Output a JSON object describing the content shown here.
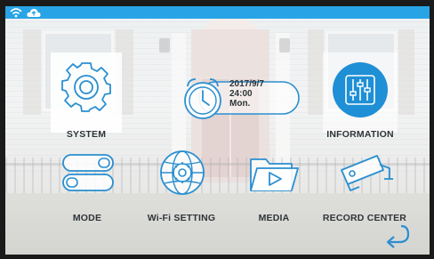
{
  "theme": {
    "accent": "#28a4e6",
    "icon_stroke": "#2a8fd0",
    "label_color": "#2f3438"
  },
  "statusbar": {
    "icons": [
      "wifi-icon",
      "cloud-upload-icon"
    ]
  },
  "clock": {
    "date": "2017/9/7",
    "time": "24:00",
    "day": "Mon."
  },
  "menu": {
    "system": {
      "label": "SYSTEM",
      "icon": "gear-icon"
    },
    "information": {
      "label": "INFORMATION",
      "icon": "sliders-icon",
      "selected": true
    },
    "mode": {
      "label": "MODE",
      "icon": "toggle-switches-icon"
    },
    "wifi_setting": {
      "label": "Wi-Fi SETTING",
      "icon": "globe-gear-icon"
    },
    "media": {
      "label": "MEDIA",
      "icon": "folder-play-icon"
    },
    "record_center": {
      "label": "RECORD CENTER",
      "icon": "security-camera-icon"
    }
  },
  "navigation": {
    "back_icon": "back-arrow-icon"
  }
}
